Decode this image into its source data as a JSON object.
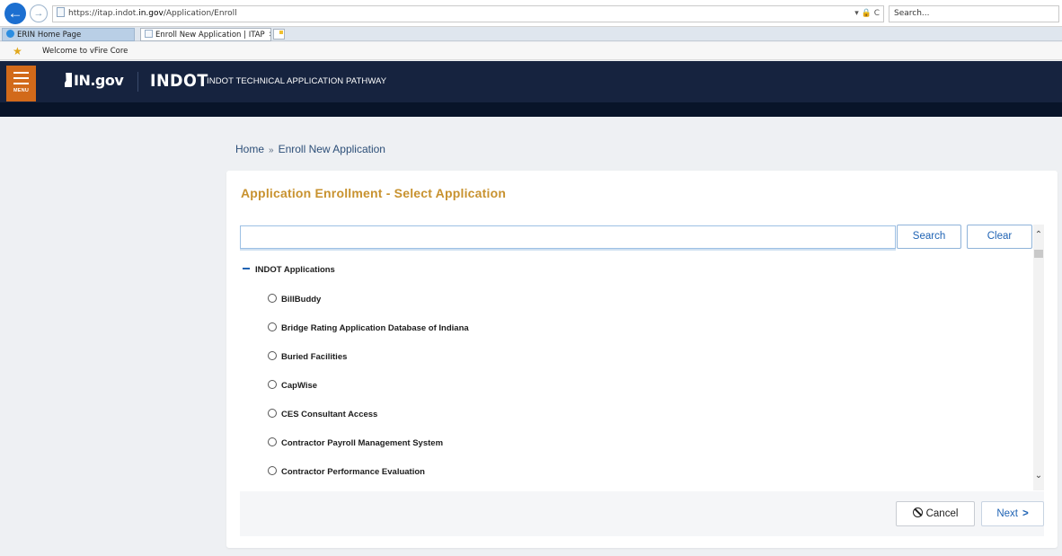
{
  "browser": {
    "url_prefix": "https://itap.indot.",
    "url_host": "in.gov",
    "url_path": "/Application/Enroll",
    "url_tools": "▾ 🔒 C",
    "search_placeholder": "Search...",
    "back_icon": "back-arrow-icon",
    "forward_icon": "forward-arrow-icon",
    "tabs": [
      {
        "label": "ERIN Home Page",
        "icon": "ie-icon"
      },
      {
        "label": "Enroll New Application | ITAP",
        "icon": "page-icon",
        "close": "✕"
      }
    ],
    "favorites": [
      {
        "label": "Welcome to vFire Core",
        "icon": "favorites-star-icon"
      }
    ]
  },
  "header": {
    "menu_label": "MENU",
    "in_logo_text": "IN.gov",
    "indot_logo_text": "INDOT",
    "subtitle": "INDOT TECHNICAL APPLICATION PATHWAY",
    "colors": {
      "header_bg": "#16233f",
      "menu_bg": "#d26a1a"
    }
  },
  "breadcrumb": {
    "home": "Home",
    "separator": "»",
    "current": "Enroll New Application"
  },
  "enrollment": {
    "title": "Application Enrollment - Select Application",
    "search_value": "",
    "search_button": "Search",
    "clear_button": "Clear",
    "group_label": "INDOT Applications",
    "applications": [
      "BillBuddy",
      "Bridge Rating Application Database of Indiana",
      "Buried Facilities",
      "CapWise",
      "CES Consultant Access",
      "Contractor Payroll Management System",
      "Contractor Performance Evaluation"
    ],
    "cancel_button": "Cancel",
    "next_button": "Next",
    "next_chevron": ">",
    "colors": {
      "title": "#c8922f",
      "accent": "#1f63b4"
    }
  }
}
